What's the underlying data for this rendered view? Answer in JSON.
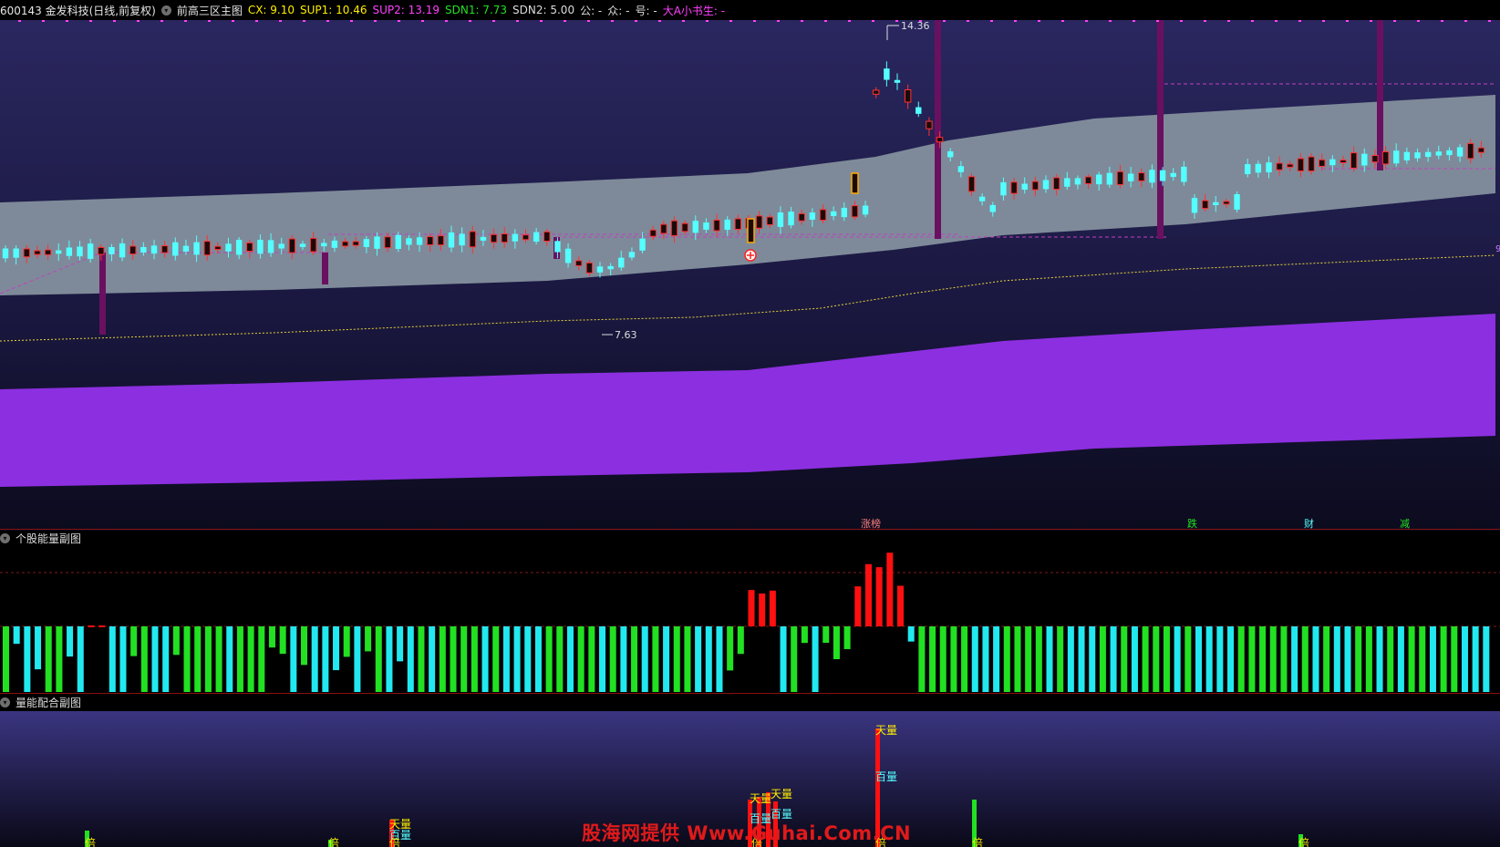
{
  "header": {
    "stock": "600143 金发科技(日线,前复权)",
    "indicator_name": "前高三区主图",
    "cx": "CX: 9.10",
    "sup1": "SUP1: 10.46",
    "sup2": "SUP2: 13.19",
    "sdn1": "SDN1: 7.73",
    "sdn2": "SDN2: 5.00",
    "gong": "公: -",
    "zhong": "众: -",
    "hao": "号: -",
    "author": "大A小书生: -"
  },
  "colors": {
    "up": "#ff3030",
    "down": "#54ffff",
    "gray_band": "#7e8a99",
    "purple_band": "#8c2fe0",
    "green_bar": "#22e022",
    "cyan_bar": "#22e8f0",
    "red_bar": "#ff1010",
    "accent_yellow": "#ffee00",
    "accent_magenta": "#ff40ff"
  },
  "main": {
    "high_label": "14.36",
    "low_label": "7.63",
    "bottom_labels": [
      {
        "text": "涨榜",
        "color": "#ff8080"
      },
      {
        "text": "跌",
        "color": "#22e022"
      },
      {
        "text": "财",
        "color": "#54ffff"
      },
      {
        "text": "减",
        "color": "#22e022"
      }
    ]
  },
  "sub1": {
    "title": "个股能量副图"
  },
  "sub2": {
    "title": "量能配合副图",
    "labels": [
      "天量",
      "百量",
      "倍"
    ]
  },
  "right_edge_marker": "9",
  "watermark": "股海网提供 Www.Guhai.Com.CN"
}
